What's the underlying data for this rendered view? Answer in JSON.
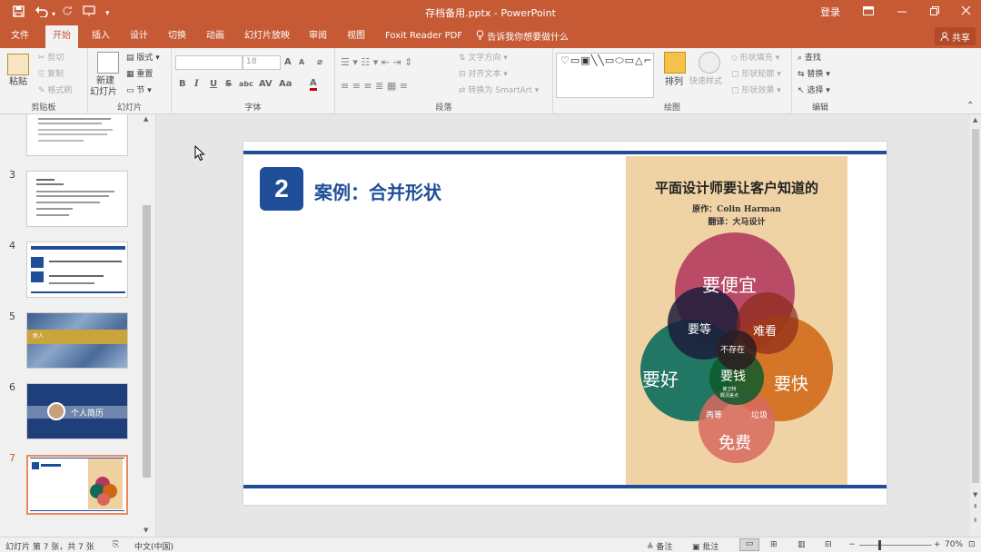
{
  "window": {
    "title": "存档备用.pptx - PowerPoint",
    "login": "登录"
  },
  "qat": {
    "save_icon": "save-icon",
    "undo_icon": "undo-icon",
    "redo_icon": "redo-icon",
    "start_icon": "start-from-beginning-icon",
    "customize_icon": "customize-qat-icon"
  },
  "tabs": [
    "文件",
    "开始",
    "插入",
    "设计",
    "切换",
    "动画",
    "幻灯片放映",
    "审阅",
    "视图",
    "Foxit Reader PDF"
  ],
  "active_tab": "开始",
  "tell_me": "告诉我你想要做什么",
  "share": "共享",
  "ribbon": {
    "clipboard": {
      "label": "剪贴板",
      "paste": "粘贴",
      "cut": "剪切",
      "copy": "复制",
      "painter": "格式刷"
    },
    "slides": {
      "label": "幻灯片",
      "new_slide_1": "新建",
      "new_slide_2": "幻灯片",
      "layout": "版式",
      "reset": "重置",
      "section": "节"
    },
    "font": {
      "label": "字体",
      "size": "18",
      "bold": "B",
      "italic": "I",
      "underline": "U",
      "strike": "S",
      "shadow": "abc",
      "grow": "A",
      "shrink": "A",
      "aa": "Aa",
      "color": "A"
    },
    "paragraph": {
      "label": "段落",
      "text_dir": "文字方向",
      "align_text": "对齐文本",
      "smartart": "转换为 SmartArt"
    },
    "drawing": {
      "label": "绘图",
      "arrange": "排列",
      "quick_styles": "快速样式",
      "fill": "形状填充",
      "outline": "形状轮廓",
      "effects": "形状效果",
      "shapes_glyphs": "♡▭▣╲╲▭⬭▭△⌐⌐⬦⇩⬠✎⌒⌒╲"
    },
    "editing": {
      "label": "编辑",
      "find": "查找",
      "replace": "替换",
      "select": "选择"
    }
  },
  "thumbnails": [
    {
      "num": "3"
    },
    {
      "num": "4"
    },
    {
      "num": "5",
      "title": "新人"
    },
    {
      "num": "6",
      "title": "个人简历"
    },
    {
      "num": "7",
      "selected": true
    }
  ],
  "slide": {
    "number": "2",
    "title": "案例：合并形状",
    "accent_color": "#1f4e99",
    "poster": {
      "title": "平面设计师要让客户知道的",
      "author": "原作：Colin Harman",
      "translator": "翻译：大马设计",
      "venn": {
        "top": "要便宜",
        "left": "要好",
        "right": "要快",
        "bottom": "免费",
        "tl": "要等",
        "tr": "难看",
        "center_top": "不存在",
        "center": "要钱",
        "center_small": "被卫特\n概况差点",
        "bl": "再等",
        "br": "垃圾"
      }
    }
  },
  "status": {
    "slide_info": "幻灯片 第 7 张，共 7 张",
    "language": "中文(中国)",
    "notes": "备注",
    "comments": "批注",
    "zoom": "70%"
  }
}
